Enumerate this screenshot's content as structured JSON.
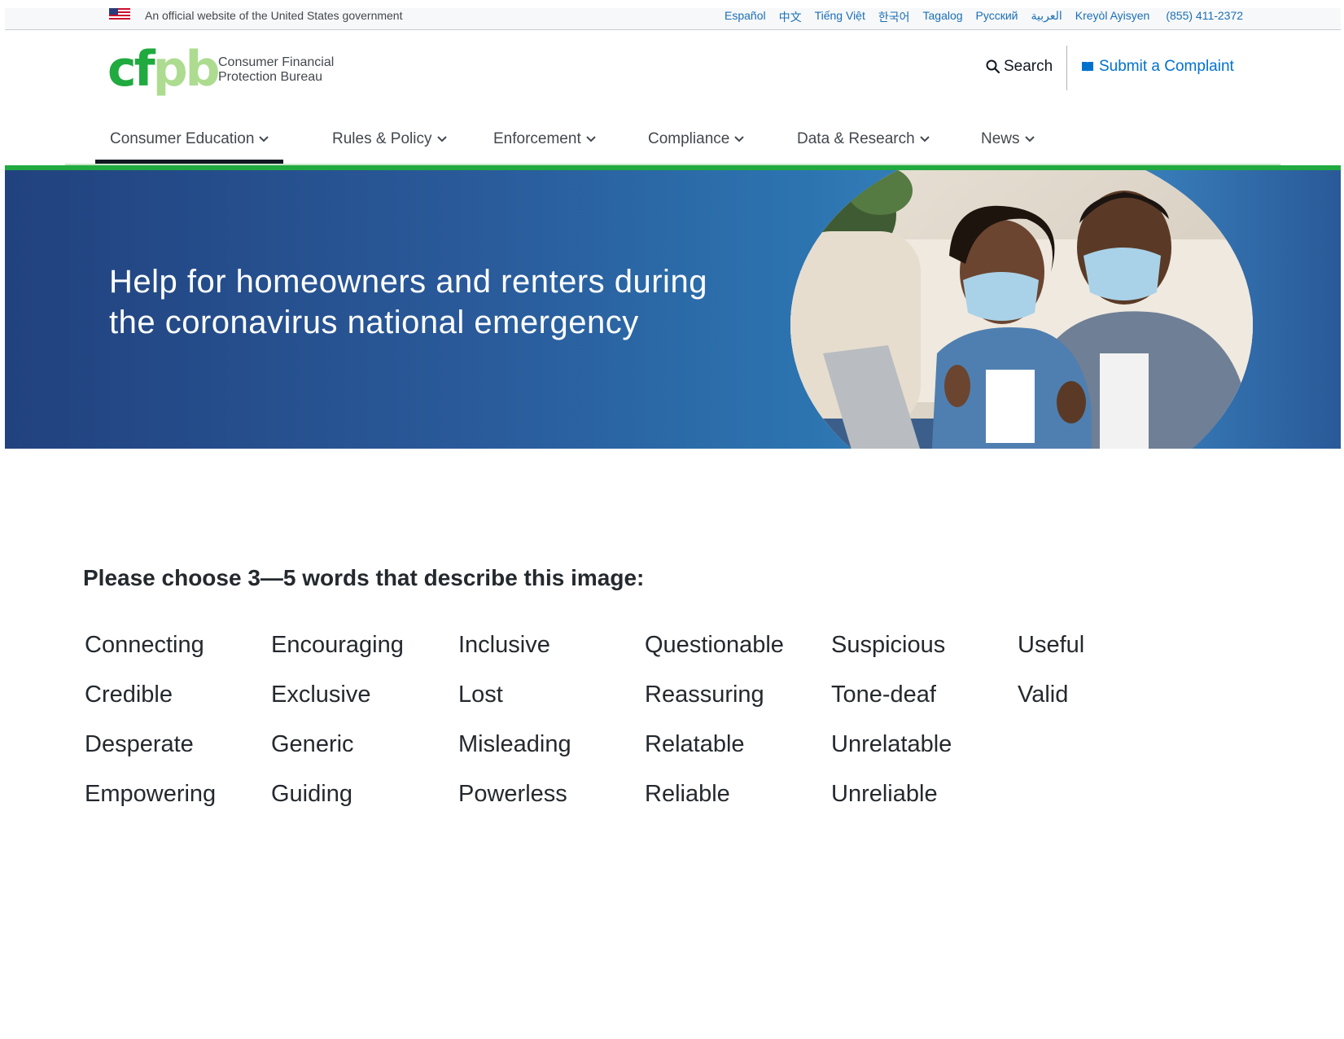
{
  "gov_banner": {
    "official_text": "An official website of the United States government",
    "languages": [
      "Español",
      "中文",
      "Tiếng Việt",
      "한국어",
      "Tagalog",
      "Русский",
      "العربية",
      "Kreyòl Ayisyen"
    ],
    "phone": "(855) 411-2372"
  },
  "header": {
    "logo_line1": "Consumer Financial",
    "logo_line2": "Protection Bureau",
    "search_label": "Search",
    "complaint_label": "Submit a Complaint"
  },
  "nav": {
    "items": [
      {
        "label": "Consumer Education"
      },
      {
        "label": "Rules & Policy"
      },
      {
        "label": "Enforcement"
      },
      {
        "label": "Compliance"
      },
      {
        "label": "Data & Research"
      },
      {
        "label": "News"
      }
    ]
  },
  "hero": {
    "title_line1": "Help for homeowners and renters during",
    "title_line2": "the coronavirus national emergency"
  },
  "survey": {
    "prompt": "Please choose 3—5 words that describe this image:",
    "columns": [
      [
        "Connecting",
        "Credible",
        "Desperate",
        "Empowering"
      ],
      [
        "Encouraging",
        "Exclusive",
        "Generic",
        "Guiding"
      ],
      [
        "Inclusive",
        "Lost",
        "Misleading",
        "Powerless"
      ],
      [
        "Questionable",
        "Reassuring",
        "Relatable",
        "Reliable"
      ],
      [
        "Suspicious",
        "Tone-deaf",
        "Unrelatable",
        "Unreliable"
      ],
      [
        "Useful",
        "Valid"
      ]
    ]
  },
  "colors": {
    "brand_green": "#20aa3f",
    "link_blue": "#0072ce",
    "hero_blue": "#2a5a9a"
  }
}
